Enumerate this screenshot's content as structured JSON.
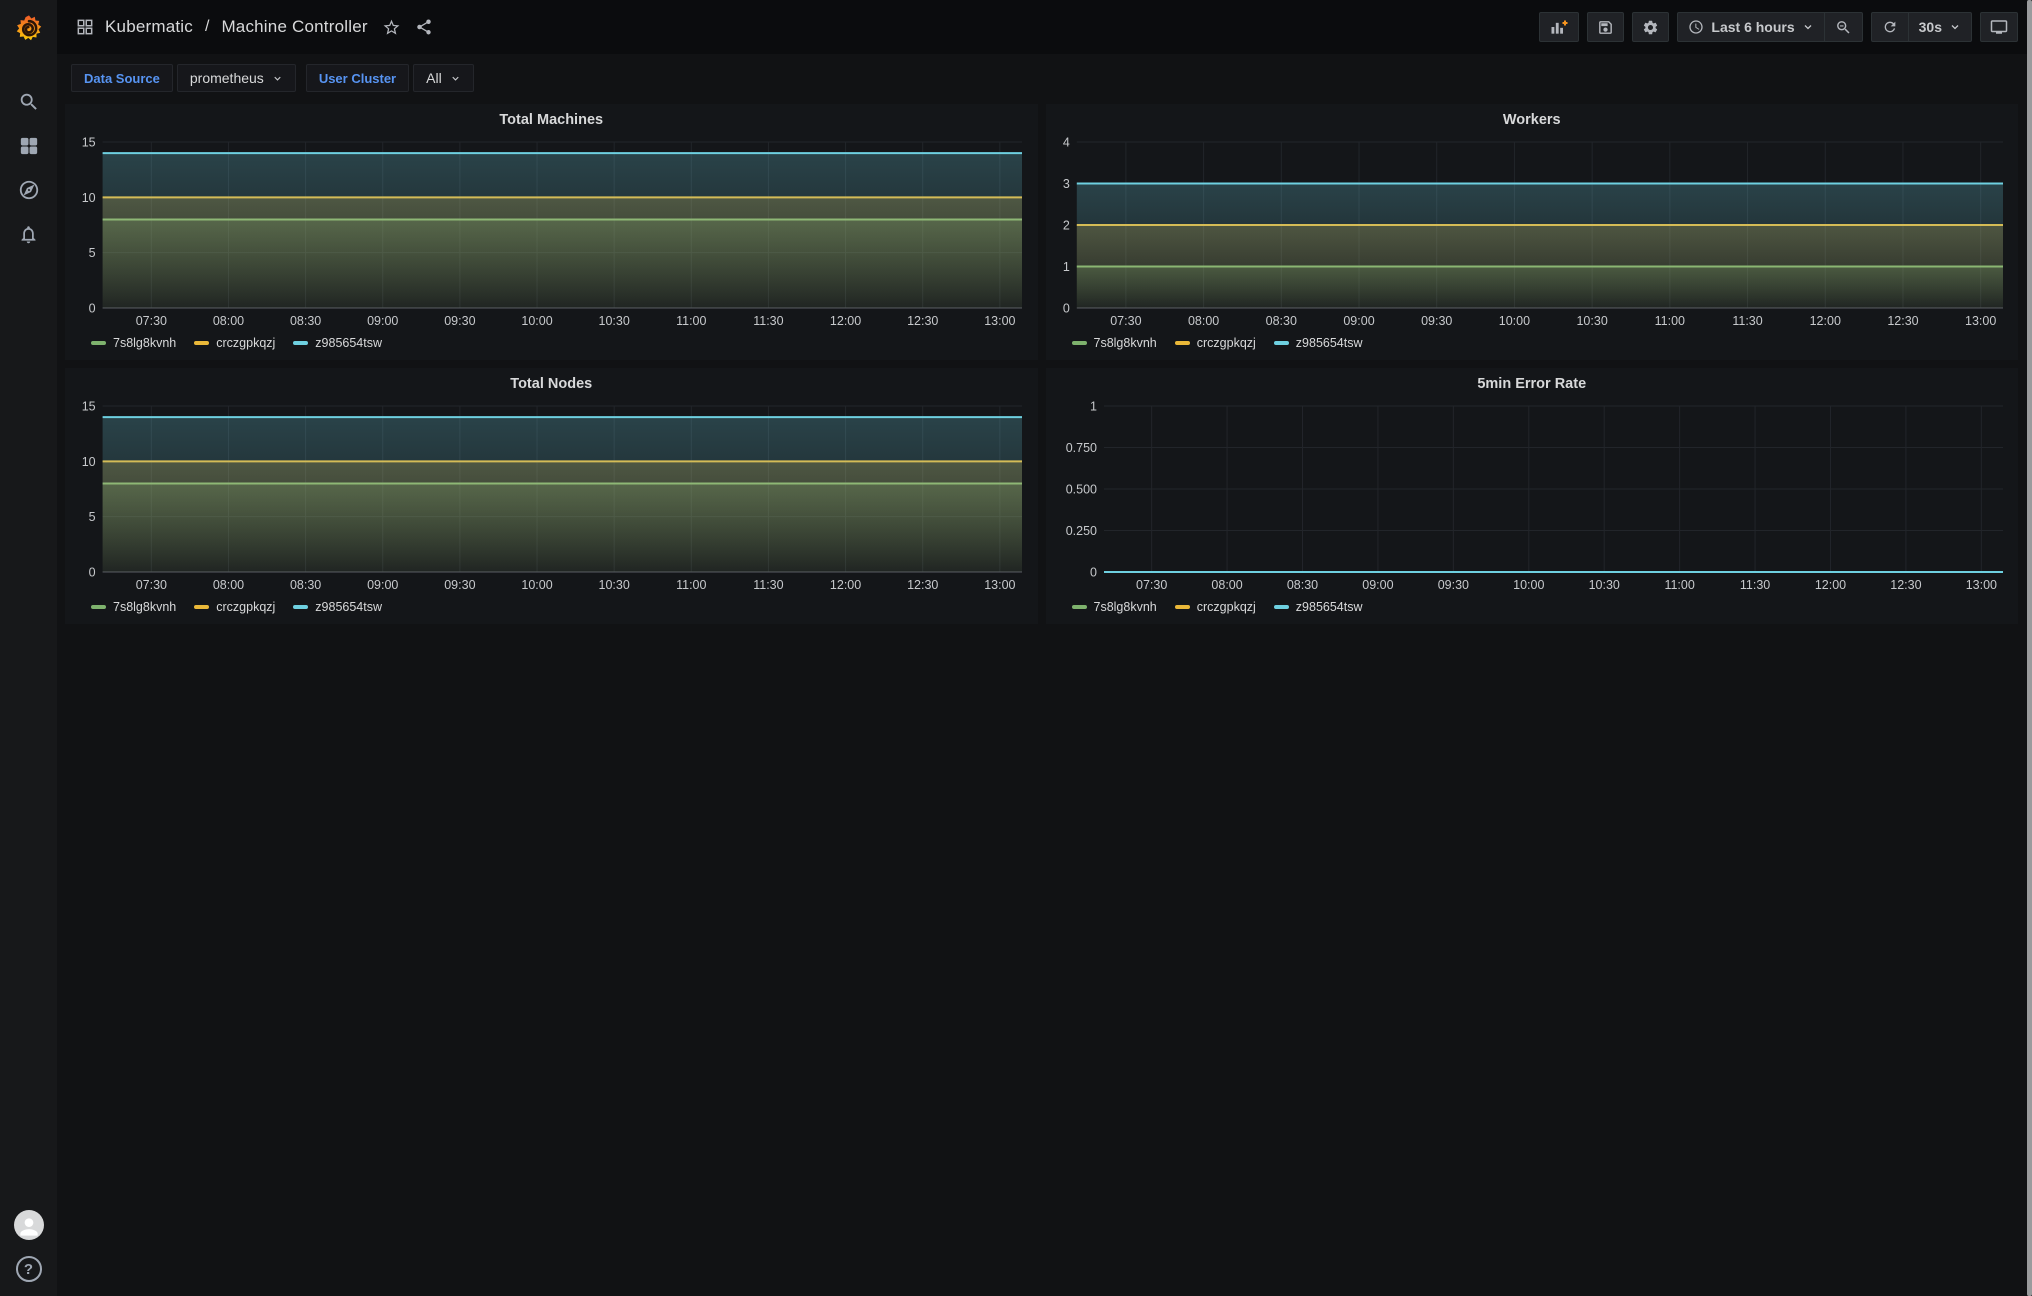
{
  "nav": {
    "breadcrumb": {
      "folder": "Kubermatic",
      "separator": "/",
      "dashboard": "Machine Controller"
    },
    "icons": [
      "apps-icon",
      "star-icon",
      "share-icon"
    ],
    "toolbar": {
      "add_panel_icon": "add-panel-icon",
      "save_icon": "save-icon",
      "settings_icon": "settings-gear-icon",
      "time_range": "Last 6 hours",
      "zoom_out_icon": "zoom-out-icon",
      "refresh_icon": "refresh-icon",
      "refresh_interval": "30s",
      "kiosk_icon": "tv-kiosk-icon"
    }
  },
  "submenu": {
    "variables": [
      {
        "label": "Data Source",
        "value": "prometheus"
      },
      {
        "label": "User Cluster",
        "value": "All"
      }
    ]
  },
  "sidebar": {
    "icons": [
      "search-icon",
      "dashboards-icon",
      "explore-compass-icon",
      "alerting-bell-icon"
    ],
    "bottom_icons": [
      "avatar",
      "help-icon"
    ]
  },
  "palette": {
    "green": "#7EB26D",
    "yellow": "#EAB839",
    "cyan": "#6ED0E0"
  },
  "time_ticks": [
    "07:30",
    "08:00",
    "08:30",
    "09:00",
    "09:30",
    "10:00",
    "10:30",
    "11:00",
    "11:30",
    "12:00",
    "12:30",
    "13:00"
  ],
  "chart_data": [
    {
      "type": "line",
      "title": "Total Machines",
      "xlabel": "",
      "ylabel": "",
      "ylim": [
        0,
        15
      ],
      "y_ticks": [
        {
          "v": 0,
          "label": "0"
        },
        {
          "v": 5,
          "label": "5"
        },
        {
          "v": 10,
          "label": "10"
        },
        {
          "v": 15,
          "label": "15"
        }
      ],
      "x": [
        "07:30",
        "08:00",
        "08:30",
        "09:00",
        "09:30",
        "10:00",
        "10:30",
        "11:00",
        "11:30",
        "12:00",
        "12:30",
        "13:00"
      ],
      "grid": true,
      "legend_position": "bottom",
      "series": [
        {
          "name": "7s8lg8kvnh",
          "color": "#7EB26D",
          "constant_value": 8
        },
        {
          "name": "crczgpkqzj",
          "color": "#EAB839",
          "constant_value": 10
        },
        {
          "name": "z985654tsw",
          "color": "#6ED0E0",
          "constant_value": 14
        }
      ]
    },
    {
      "type": "line",
      "title": "Workers",
      "xlabel": "",
      "ylabel": "",
      "ylim": [
        0,
        4
      ],
      "y_ticks": [
        {
          "v": 0,
          "label": "0"
        },
        {
          "v": 1,
          "label": "1"
        },
        {
          "v": 2,
          "label": "2"
        },
        {
          "v": 3,
          "label": "3"
        },
        {
          "v": 4,
          "label": "4"
        }
      ],
      "x": [
        "07:30",
        "08:00",
        "08:30",
        "09:00",
        "09:30",
        "10:00",
        "10:30",
        "11:00",
        "11:30",
        "12:00",
        "12:30",
        "13:00"
      ],
      "grid": true,
      "legend_position": "bottom",
      "series": [
        {
          "name": "7s8lg8kvnh",
          "color": "#7EB26D",
          "constant_value": 1
        },
        {
          "name": "crczgpkqzj",
          "color": "#EAB839",
          "constant_value": 2
        },
        {
          "name": "z985654tsw",
          "color": "#6ED0E0",
          "constant_value": 3
        }
      ]
    },
    {
      "type": "line",
      "title": "Total Nodes",
      "xlabel": "",
      "ylabel": "",
      "ylim": [
        0,
        15
      ],
      "y_ticks": [
        {
          "v": 0,
          "label": "0"
        },
        {
          "v": 5,
          "label": "5"
        },
        {
          "v": 10,
          "label": "10"
        },
        {
          "v": 15,
          "label": "15"
        }
      ],
      "x": [
        "07:30",
        "08:00",
        "08:30",
        "09:00",
        "09:30",
        "10:00",
        "10:30",
        "11:00",
        "11:30",
        "12:00",
        "12:30",
        "13:00"
      ],
      "grid": true,
      "legend_position": "bottom",
      "series": [
        {
          "name": "7s8lg8kvnh",
          "color": "#7EB26D",
          "constant_value": 8
        },
        {
          "name": "crczgpkqzj",
          "color": "#EAB839",
          "constant_value": 10
        },
        {
          "name": "z985654tsw",
          "color": "#6ED0E0",
          "constant_value": 14
        }
      ]
    },
    {
      "type": "line",
      "title": "5min Error Rate",
      "xlabel": "",
      "ylabel": "",
      "ylim": [
        0,
        1
      ],
      "y_ticks": [
        {
          "v": 0,
          "label": "0"
        },
        {
          "v": 0.25,
          "label": "0.250"
        },
        {
          "v": 0.5,
          "label": "0.500"
        },
        {
          "v": 0.75,
          "label": "0.750"
        },
        {
          "v": 1,
          "label": "1"
        }
      ],
      "x": [
        "07:30",
        "08:00",
        "08:30",
        "09:00",
        "09:30",
        "10:00",
        "10:30",
        "11:00",
        "11:30",
        "12:00",
        "12:30",
        "13:00"
      ],
      "grid": true,
      "legend_position": "bottom",
      "series": [
        {
          "name": "7s8lg8kvnh",
          "color": "#7EB26D",
          "constant_value": 0
        },
        {
          "name": "crczgpkqzj",
          "color": "#EAB839",
          "constant_value": 0
        },
        {
          "name": "z985654tsw",
          "color": "#6ED0E0",
          "constant_value": 0
        }
      ]
    }
  ]
}
